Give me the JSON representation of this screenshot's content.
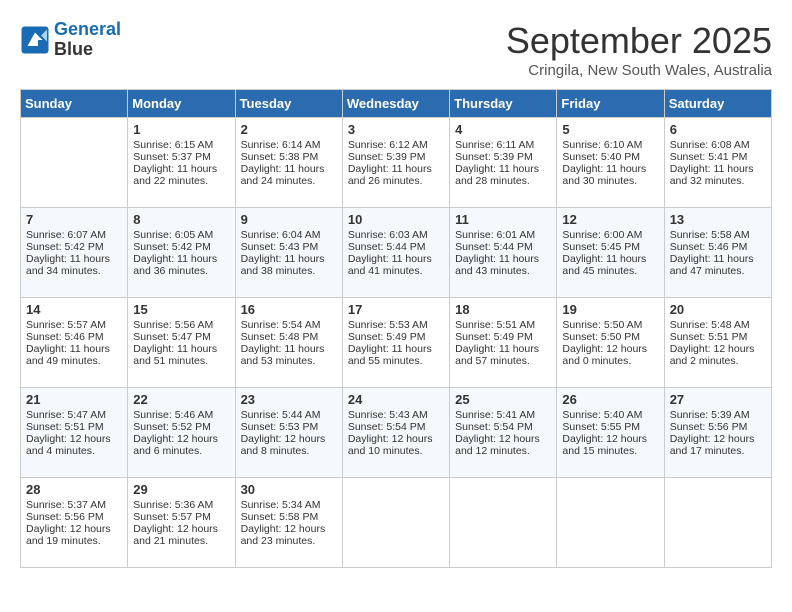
{
  "app": {
    "logo_line1": "General",
    "logo_line2": "Blue"
  },
  "title": "September 2025",
  "location": "Cringila, New South Wales, Australia",
  "days_of_week": [
    "Sunday",
    "Monday",
    "Tuesday",
    "Wednesday",
    "Thursday",
    "Friday",
    "Saturday"
  ],
  "weeks": [
    [
      {
        "day": "",
        "sunrise": "",
        "sunset": "",
        "daylight": ""
      },
      {
        "day": "1",
        "sunrise": "Sunrise: 6:15 AM",
        "sunset": "Sunset: 5:37 PM",
        "daylight": "Daylight: 11 hours and 22 minutes."
      },
      {
        "day": "2",
        "sunrise": "Sunrise: 6:14 AM",
        "sunset": "Sunset: 5:38 PM",
        "daylight": "Daylight: 11 hours and 24 minutes."
      },
      {
        "day": "3",
        "sunrise": "Sunrise: 6:12 AM",
        "sunset": "Sunset: 5:39 PM",
        "daylight": "Daylight: 11 hours and 26 minutes."
      },
      {
        "day": "4",
        "sunrise": "Sunrise: 6:11 AM",
        "sunset": "Sunset: 5:39 PM",
        "daylight": "Daylight: 11 hours and 28 minutes."
      },
      {
        "day": "5",
        "sunrise": "Sunrise: 6:10 AM",
        "sunset": "Sunset: 5:40 PM",
        "daylight": "Daylight: 11 hours and 30 minutes."
      },
      {
        "day": "6",
        "sunrise": "Sunrise: 6:08 AM",
        "sunset": "Sunset: 5:41 PM",
        "daylight": "Daylight: 11 hours and 32 minutes."
      }
    ],
    [
      {
        "day": "7",
        "sunrise": "Sunrise: 6:07 AM",
        "sunset": "Sunset: 5:42 PM",
        "daylight": "Daylight: 11 hours and 34 minutes."
      },
      {
        "day": "8",
        "sunrise": "Sunrise: 6:05 AM",
        "sunset": "Sunset: 5:42 PM",
        "daylight": "Daylight: 11 hours and 36 minutes."
      },
      {
        "day": "9",
        "sunrise": "Sunrise: 6:04 AM",
        "sunset": "Sunset: 5:43 PM",
        "daylight": "Daylight: 11 hours and 38 minutes."
      },
      {
        "day": "10",
        "sunrise": "Sunrise: 6:03 AM",
        "sunset": "Sunset: 5:44 PM",
        "daylight": "Daylight: 11 hours and 41 minutes."
      },
      {
        "day": "11",
        "sunrise": "Sunrise: 6:01 AM",
        "sunset": "Sunset: 5:44 PM",
        "daylight": "Daylight: 11 hours and 43 minutes."
      },
      {
        "day": "12",
        "sunrise": "Sunrise: 6:00 AM",
        "sunset": "Sunset: 5:45 PM",
        "daylight": "Daylight: 11 hours and 45 minutes."
      },
      {
        "day": "13",
        "sunrise": "Sunrise: 5:58 AM",
        "sunset": "Sunset: 5:46 PM",
        "daylight": "Daylight: 11 hours and 47 minutes."
      }
    ],
    [
      {
        "day": "14",
        "sunrise": "Sunrise: 5:57 AM",
        "sunset": "Sunset: 5:46 PM",
        "daylight": "Daylight: 11 hours and 49 minutes."
      },
      {
        "day": "15",
        "sunrise": "Sunrise: 5:56 AM",
        "sunset": "Sunset: 5:47 PM",
        "daylight": "Daylight: 11 hours and 51 minutes."
      },
      {
        "day": "16",
        "sunrise": "Sunrise: 5:54 AM",
        "sunset": "Sunset: 5:48 PM",
        "daylight": "Daylight: 11 hours and 53 minutes."
      },
      {
        "day": "17",
        "sunrise": "Sunrise: 5:53 AM",
        "sunset": "Sunset: 5:49 PM",
        "daylight": "Daylight: 11 hours and 55 minutes."
      },
      {
        "day": "18",
        "sunrise": "Sunrise: 5:51 AM",
        "sunset": "Sunset: 5:49 PM",
        "daylight": "Daylight: 11 hours and 57 minutes."
      },
      {
        "day": "19",
        "sunrise": "Sunrise: 5:50 AM",
        "sunset": "Sunset: 5:50 PM",
        "daylight": "Daylight: 12 hours and 0 minutes."
      },
      {
        "day": "20",
        "sunrise": "Sunrise: 5:48 AM",
        "sunset": "Sunset: 5:51 PM",
        "daylight": "Daylight: 12 hours and 2 minutes."
      }
    ],
    [
      {
        "day": "21",
        "sunrise": "Sunrise: 5:47 AM",
        "sunset": "Sunset: 5:51 PM",
        "daylight": "Daylight: 12 hours and 4 minutes."
      },
      {
        "day": "22",
        "sunrise": "Sunrise: 5:46 AM",
        "sunset": "Sunset: 5:52 PM",
        "daylight": "Daylight: 12 hours and 6 minutes."
      },
      {
        "day": "23",
        "sunrise": "Sunrise: 5:44 AM",
        "sunset": "Sunset: 5:53 PM",
        "daylight": "Daylight: 12 hours and 8 minutes."
      },
      {
        "day": "24",
        "sunrise": "Sunrise: 5:43 AM",
        "sunset": "Sunset: 5:54 PM",
        "daylight": "Daylight: 12 hours and 10 minutes."
      },
      {
        "day": "25",
        "sunrise": "Sunrise: 5:41 AM",
        "sunset": "Sunset: 5:54 PM",
        "daylight": "Daylight: 12 hours and 12 minutes."
      },
      {
        "day": "26",
        "sunrise": "Sunrise: 5:40 AM",
        "sunset": "Sunset: 5:55 PM",
        "daylight": "Daylight: 12 hours and 15 minutes."
      },
      {
        "day": "27",
        "sunrise": "Sunrise: 5:39 AM",
        "sunset": "Sunset: 5:56 PM",
        "daylight": "Daylight: 12 hours and 17 minutes."
      }
    ],
    [
      {
        "day": "28",
        "sunrise": "Sunrise: 5:37 AM",
        "sunset": "Sunset: 5:56 PM",
        "daylight": "Daylight: 12 hours and 19 minutes."
      },
      {
        "day": "29",
        "sunrise": "Sunrise: 5:36 AM",
        "sunset": "Sunset: 5:57 PM",
        "daylight": "Daylight: 12 hours and 21 minutes."
      },
      {
        "day": "30",
        "sunrise": "Sunrise: 5:34 AM",
        "sunset": "Sunset: 5:58 PM",
        "daylight": "Daylight: 12 hours and 23 minutes."
      },
      {
        "day": "",
        "sunrise": "",
        "sunset": "",
        "daylight": ""
      },
      {
        "day": "",
        "sunrise": "",
        "sunset": "",
        "daylight": ""
      },
      {
        "day": "",
        "sunrise": "",
        "sunset": "",
        "daylight": ""
      },
      {
        "day": "",
        "sunrise": "",
        "sunset": "",
        "daylight": ""
      }
    ]
  ]
}
